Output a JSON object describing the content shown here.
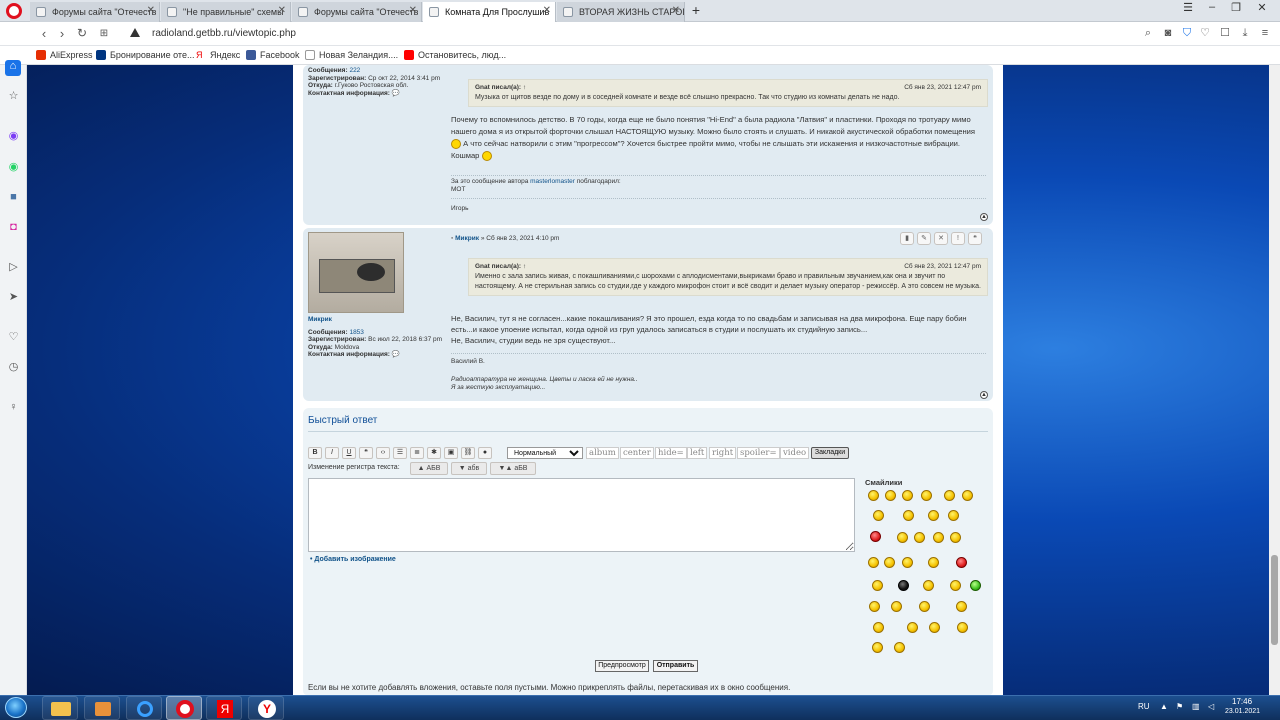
{
  "browser": {
    "tabs": [
      {
        "title": "Форумы сайта \"Отечеств",
        "active": false
      },
      {
        "title": "\"Не правильные\" схемы",
        "active": false
      },
      {
        "title": "Форумы сайта \"Отечеств",
        "active": false
      },
      {
        "title": "Комната Для Прослушив",
        "active": true
      },
      {
        "title": "ВТОРАЯ ЖИЗНЬ СТАРОГО",
        "active": false
      }
    ],
    "url": "radioland.getbb.ru/viewtopic.php",
    "bookmarks": [
      "AliExpress",
      "Бронирование оте...",
      "Яндекс",
      "Facebook",
      "Новая Зеландия....",
      "Остановитесь, люд..."
    ]
  },
  "post1": {
    "meta": {
      "messages_label": "Сообщения:",
      "messages": "222",
      "registered_label": "Зарегистрирован:",
      "registered": "Ср окт 22, 2014 3:41 pm",
      "from_label": "Откуда:",
      "from": "г.Гуково Ростовская обл.",
      "contact_label": "Контактная информация:"
    },
    "quote": {
      "author": "Gnat писал(а): ↑",
      "date": "Сб янв 23, 2021 12:47 pm",
      "text": "Музыка от щитов везде по дому и в соседней комнате и везде всё слышно прекрасно. Так что студию из комнаты делать не надо."
    },
    "text1": "Почему то вспомнилось детство. В 70 годы, когда еще не было понятия \"Hi-End\" а была радиола \"Латвия\" и пластинки. Проходя по тротуару мимо нашего дома я из открытой форточки слышал НАСТОЯЩУЮ музыку. Можно было стоять и слушать. И никакой акустической обработки помещения",
    "text2": "А что сейчас натворили с этим \"прогрессом\"? Хочется быстрее пройти мимо, чтобы не слышать эти искажения и низкочастотные вибрации.",
    "text3": "Кошмар",
    "thanks_prefix": "За это сообщение автора",
    "thanks_user": "masterlomaster",
    "thanks_suffix": "поблагодарил:",
    "thanks_who": "МОТ",
    "signature": "Игорь"
  },
  "post2": {
    "author": "Микрик",
    "header_sep": "»",
    "date": "Сб янв 23, 2021 4:10 pm",
    "meta": {
      "name": "Микрик",
      "messages_label": "Сообщения:",
      "messages": "1853",
      "registered_label": "Зарегистрирован:",
      "registered": "Вс июл 22, 2018 6:37 pm",
      "from_label": "Откуда:",
      "from": "Moldova",
      "contact_label": "Контактная информация:"
    },
    "quote": {
      "author": "Gnat писал(а): ↑",
      "date": "Сб янв 23, 2021 12:47 pm",
      "text": "Именно с зала запись живая, с покашливаниями,с шорохами с аплодисментами,выкриками браво и правильным звучанием,как она и звучит по настоящему. А не стерильная запись со студии,где у каждого микрофон стоит и всё сводит и делает музыку оператор - режиссёр. А это совсем не музыка."
    },
    "text": "Не, Василич, тут я не согласен...какие покашливания? Я это прошел, езда когда то по свадьбам и записывая на два микрофона. Еще пару бобин есть...и какое упоение испытал, когда одной из груп удалось записаться в студии и послушать их студийную запись...\nНе, Василич, студии ведь не зря существуют...",
    "signature": "Василий В.",
    "sig_line1": "Радиоаппаратура не женщина. Цветы и ласка ей не нужна..",
    "sig_line2": "Я за жесткую эксплуатацию..."
  },
  "quick_reply": {
    "title": "Быстрый ответ",
    "font_select": "Нормальный",
    "word_buttons": [
      "album",
      "center",
      "hide=",
      "left",
      "right",
      "spoiler=",
      "video"
    ],
    "bookmarks_btn": "Закладки",
    "case_label": "Изменение регистра текста:",
    "case_buttons": [
      "▲ АБВ",
      "▼ абв",
      "▼▲ аБВ"
    ],
    "add_image": "• Добавить изображение",
    "smilies_title": "Смайлики",
    "preview_btn": "Предпросмотр",
    "submit_btn": "Отправить",
    "attach_note": "Если вы не хотите добавлять вложения, оставьте поля пустыми. Можно прикреплять файлы, перетаскивая их в окно сообщения."
  },
  "taskbar": {
    "lang": "RU",
    "time": "17:46",
    "date": "23.01.2021"
  }
}
